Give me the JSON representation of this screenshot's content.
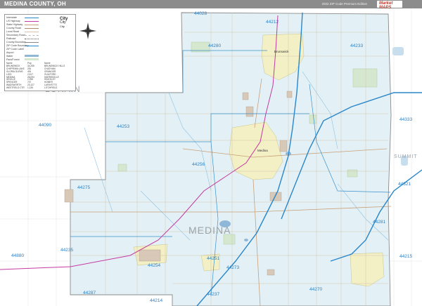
{
  "header": {
    "title": "MEDINA COUNTY, OH",
    "edition": "2022 ZIP Code Premium Edition",
    "brand": "Market MAPS"
  },
  "map": {
    "county_label": "MEDINA",
    "neighbor_labels": [
      "LORAIN",
      "SUMMIT"
    ],
    "zip_codes": [
      "44028",
      "44212",
      "44280",
      "44233",
      "44090",
      "44253",
      "44333",
      "44256",
      "44321",
      "44275",
      "44281",
      "44235",
      "44880",
      "44251",
      "44254",
      "44273",
      "44270",
      "44215",
      "44287",
      "44237",
      "44214"
    ],
    "city_labels": [
      "Brunswick",
      "Medina"
    ],
    "colors": {
      "county_fill": "#e3f1f6",
      "city_fill": "#f2f0c4",
      "zip_label": "#2a7fc4",
      "title_bar": "#8c8c8c",
      "water": "#8fb8d8",
      "interstate": "#2a86c8",
      "us_route": "#c43aa0"
    }
  },
  "legend": {
    "rows": [
      "Interstate",
      "US Highway",
      "State Highway",
      "County Road",
      "Local Road",
      "Secondary Road",
      "Railroad",
      "County Boundary",
      "ZIP Code Boundary",
      "ZIP Code Label",
      "Airport",
      "Water",
      "Park/Forest"
    ],
    "city_symbols": [
      "City",
      "City",
      "City"
    ],
    "population_col1": "Name\nBRUNSWICK\nCHIPPEWA LAKE\nGLORIA GLENS\nLODI\nMEDINA\nSEVILLE\nSPENCER\nWADSWORTH\nWESTFIELD CTR",
    "population_col2": "Pop\n34,255\n251\n491\n2,517\n26,094\n2,296\n747\n23,127\n1,135",
    "population_col3": "Name\nBRUNSWICK HILLS\nCHATHAM\nGRANGER\nGUILFORD\nHARRISVILLE\nHINCKLEY\nHOMER\nLAFAYETTE\nLITCHFIELD"
  }
}
